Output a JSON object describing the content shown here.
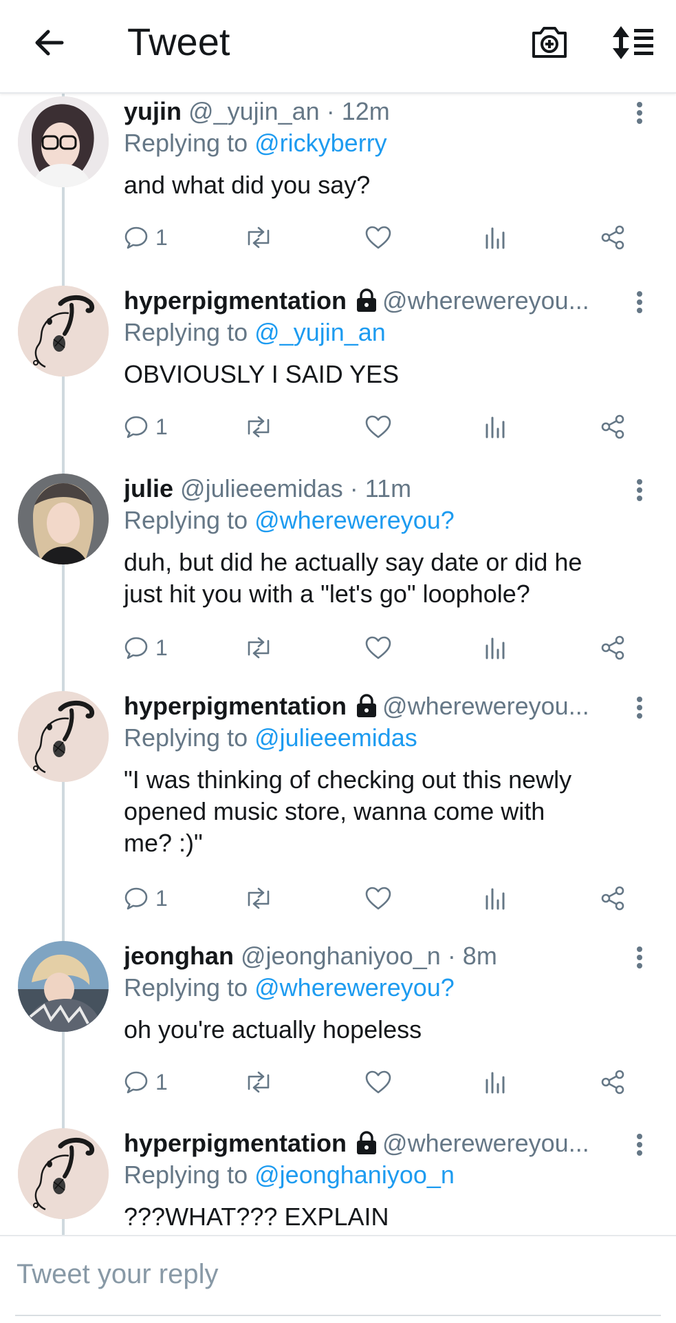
{
  "header": {
    "title": "Tweet",
    "back_icon": "arrow-left-icon",
    "camera_icon": "camera-plus-icon",
    "sort_icon": "sort-list-icon"
  },
  "composer": {
    "placeholder": "Tweet your reply"
  },
  "colors": {
    "link": "#1d9bf0",
    "muted": "#657786",
    "text": "#14171a",
    "thread_line": "#cfd9de"
  },
  "tweets": [
    {
      "name": "yujin",
      "handle": "@_yujin_an",
      "time": "· 12m",
      "locked": false,
      "reply_label": "Replying to",
      "reply_to": "@rickyberry",
      "lines": [
        "and what did you say?"
      ],
      "reply_count": "1",
      "avatar": "photo-avatar"
    },
    {
      "name": "hyperpigmentation",
      "handle": "@wherewereyou...",
      "time": "",
      "locked": true,
      "reply_label": "Replying to",
      "reply_to": "@_yujin_an",
      "lines": [
        "OBVIOUSLY I SAID YES"
      ],
      "reply_count": "1",
      "avatar": "doodle-avatar"
    },
    {
      "name": "julie",
      "handle": "@julieeemidas",
      "time": "· 11m",
      "locked": false,
      "reply_label": "Replying to",
      "reply_to": "@wherewereyou?",
      "lines": [
        "duh, but did he actually say date or did he",
        "just hit you with a \"let's go\" loophole?"
      ],
      "reply_count": "1",
      "avatar": "photo-avatar"
    },
    {
      "name": "hyperpigmentation",
      "handle": "@wherewereyou...",
      "time": "",
      "locked": true,
      "reply_label": "Replying to",
      "reply_to": "@julieeemidas",
      "lines": [
        "\"I was thinking of checking out this newly",
        "opened music store, wanna come with",
        "me? :)\""
      ],
      "reply_count": "1",
      "avatar": "doodle-avatar"
    },
    {
      "name": "jeonghan",
      "handle": "@jeonghaniyoo_n",
      "time": "· 8m",
      "locked": false,
      "reply_label": "Replying to",
      "reply_to": "@wherewereyou?",
      "lines": [
        "oh you're actually hopeless"
      ],
      "reply_count": "1",
      "avatar": "photo-avatar"
    },
    {
      "name": "hyperpigmentation",
      "handle": "@wherewereyou...",
      "time": "",
      "locked": true,
      "reply_label": "Replying to",
      "reply_to": "@jeonghaniyoo_n",
      "lines": [
        "???WHAT??? EXPLAIN"
      ],
      "reply_count": "",
      "avatar": "doodle-avatar"
    }
  ]
}
